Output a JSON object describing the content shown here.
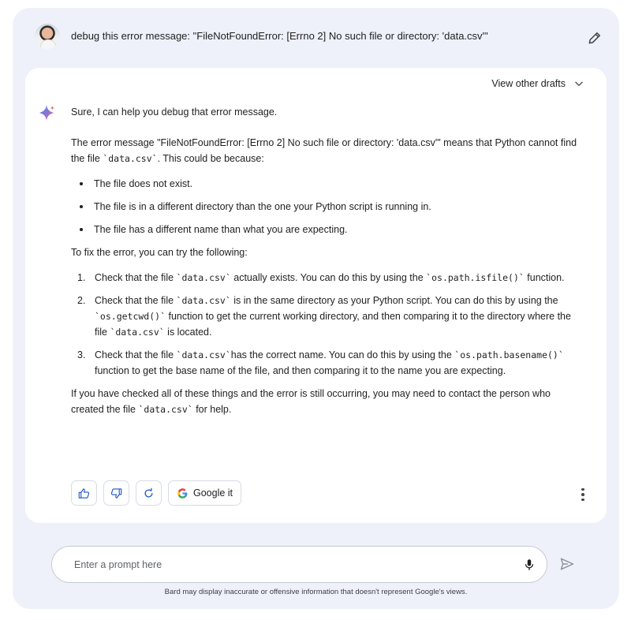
{
  "prompt": {
    "text": "debug this error message: \"FileNotFoundError: [Errno 2] No such file or directory: 'data.csv'\""
  },
  "response": {
    "drafts_label": "View other drafts",
    "intro": "Sure, I can help you debug that error message.",
    "explain_a": "The error message \"FileNotFoundError: [Errno 2] No such file or directory: 'data.csv'\" means that Python cannot find the file ",
    "explain_code": "`data.csv`",
    "explain_b": ". This could be because:",
    "bullets": [
      "The file does not exist.",
      "The file is in a different directory than the one your Python script is running in.",
      "The file has a different name than what you are expecting."
    ],
    "fix_intro": "To fix the error, you can try the following:",
    "steps": [
      {
        "num": "1.",
        "a": "Check that the file ",
        "c1": "`data.csv`",
        "b": " actually exists. You can do this by using the ",
        "c2": "`os.path.isfile()`",
        "d": " function."
      },
      {
        "num": "2.",
        "a": "Check that the file ",
        "c1": "`data.csv`",
        "b": " is in the same directory as your Python script. You can do this by using the ",
        "c2": "`os.getcwd()`",
        "d": " function to get the current working directory, and then comparing it to the directory where the file ",
        "c3": "`data.csv`",
        "e": " is located."
      },
      {
        "num": "3.",
        "a": "Check that the file ",
        "c1": "`data.csv`",
        "b": "has the correct name. You can do this by using the ",
        "c2": "`os.path.basename()`",
        "d": " function to get the base name of the file, and then comparing it to the name you are expecting."
      }
    ],
    "closing_a": "If you have checked all of these things and the error is still occurring, you may need to contact the person who created the file ",
    "closing_code": "`data.csv`",
    "closing_b": " for help."
  },
  "actions": {
    "google_label": "Google it"
  },
  "input": {
    "placeholder": "Enter a prompt here"
  },
  "footer": {
    "disclaimer": "Bard may display inaccurate or offensive information that doesn't represent Google's views."
  },
  "icons": {
    "avatar": "user-avatar",
    "edit": "pencil-icon",
    "drafts": "chevron-down-icon",
    "sparkle": "bard-sparkle-icon",
    "thumbs_up": "thumbs-up-icon",
    "thumbs_down": "thumbs-down-icon",
    "regenerate": "refresh-icon",
    "google": "google-g-icon",
    "more": "more-vert-icon",
    "mic": "mic-icon",
    "send": "send-icon"
  },
  "colors": {
    "frame": "#eef1fa",
    "card": "#ffffff",
    "accent_blue": "#4285f4",
    "text": "#1f1f1f"
  }
}
